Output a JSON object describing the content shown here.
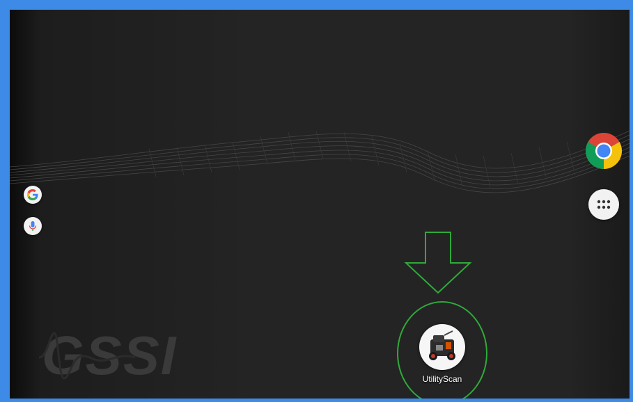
{
  "desktop": {
    "logo_text": "GSSI",
    "left_dock": {
      "google_search_icon": "google-g-icon",
      "voice_search_icon": "microphone-icon"
    },
    "right_dock": {
      "browser_icon": "chrome-icon",
      "app_drawer_icon": "apps-grid-icon"
    },
    "home_apps": [
      {
        "label": "UtilityScan",
        "icon": "utilityscan-device-icon"
      }
    ]
  },
  "annotations": {
    "highlight_color": "#2faa3a",
    "arrow_direction": "down"
  },
  "colors": {
    "frame": "#3d8be6",
    "wallpaper": "#242424"
  }
}
